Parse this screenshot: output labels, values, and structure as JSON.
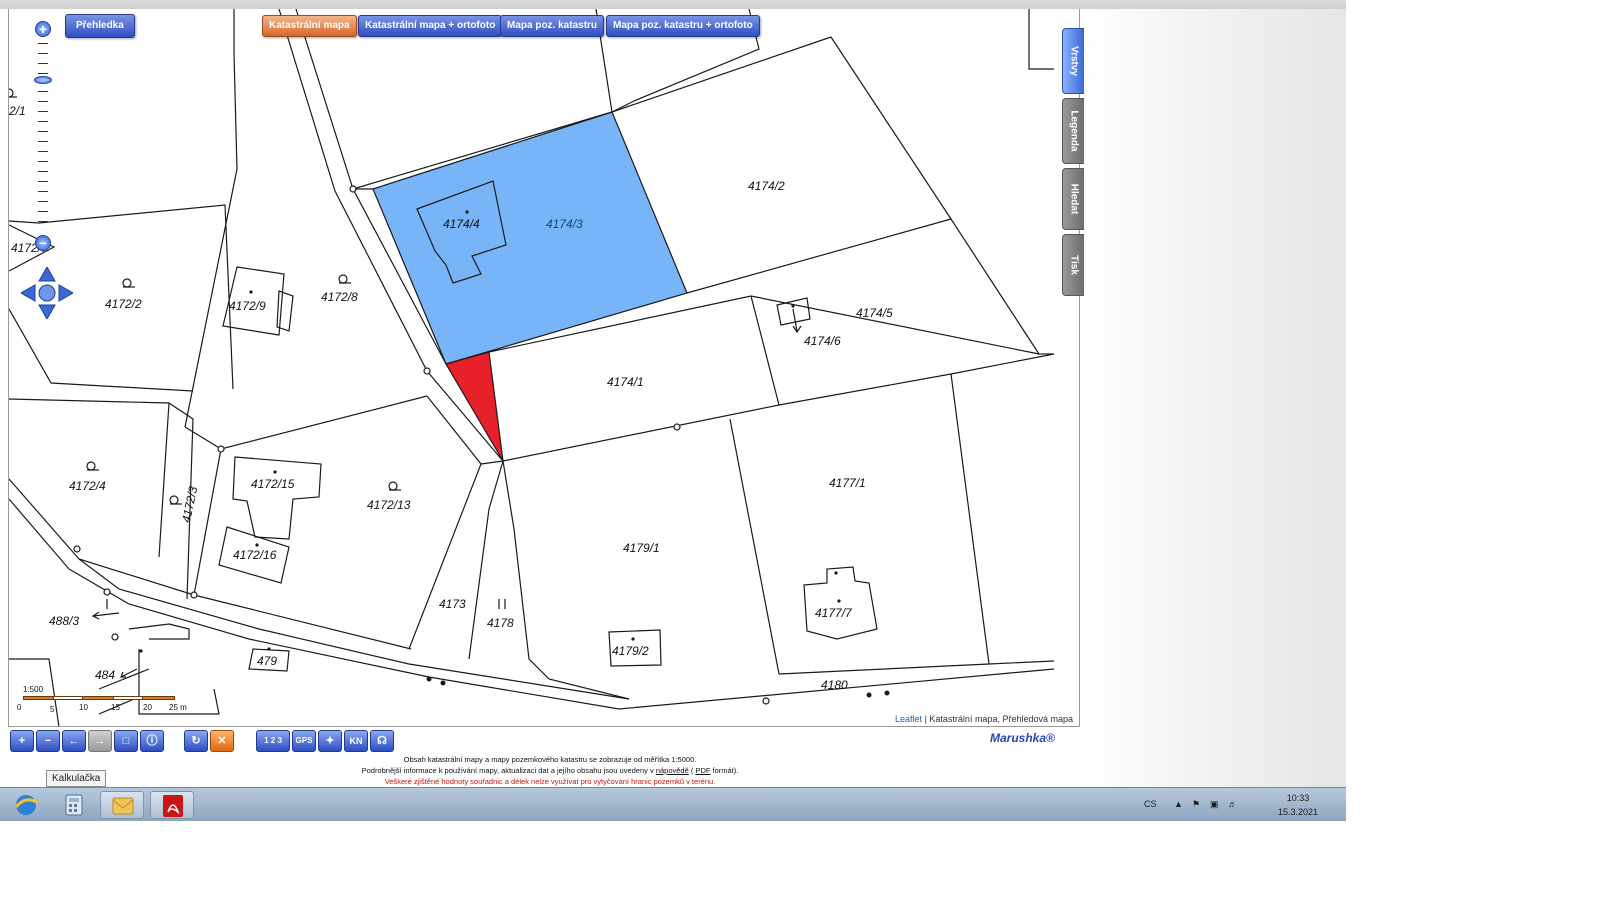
{
  "map_buttons": [
    {
      "label": "Katastrální mapa",
      "active": true
    },
    {
      "label": "Katastrální mapa + ortofoto",
      "active": false
    },
    {
      "label": "Mapa poz. katastru",
      "active": false
    },
    {
      "label": "Mapa poz. katastru + ortofoto",
      "active": false
    }
  ],
  "overview_button": "Přehledka",
  "side_tabs": [
    "Vrstvy",
    "Legenda",
    "Hledat",
    "Tisk"
  ],
  "parcel_labels": {
    "p4172_1": "2/1",
    "p4172_7": "4172/7",
    "p4172_2": "4172/2",
    "p4172_9": "4172/9",
    "p4172_8": "4172/8",
    "p4174_4": "4174/4",
    "p4174_3": "4174/3",
    "p4174_2": "4174/2",
    "p4174_5": "4174/5",
    "p4174_6": "4174/6",
    "p4174_1": "4174/1",
    "p4172_4": "4172/4",
    "p4172_3": "4172/3",
    "p4172_15": "4172/15",
    "p4172_13": "4172/13",
    "p4172_16": "4172/16",
    "p4177_1": "4177/1",
    "p4179_1": "4179/1",
    "p488_3": "488/3",
    "p4173": "4173",
    "p4178": "4178",
    "p4177_7": "4177/7",
    "p479": "479",
    "p484": "484",
    "p4179_2": "4179/2",
    "p4180": "4180"
  },
  "map_colors": {
    "selected_parcel": "#78b4f8",
    "highlight_parcel": "#e8202a",
    "line": "#1a1a1a"
  },
  "scale": {
    "ratio": "1:500",
    "ticks": [
      "0",
      "5",
      "10",
      "15",
      "20",
      "25 m"
    ]
  },
  "attribution": {
    "link": "Leaflet",
    "text": "| Katastrální mapa, Přehledová mapa"
  },
  "toolbar_icons": [
    "zoom-in-icon",
    "zoom-out-icon",
    "back-icon",
    "forward-icon",
    "select-area-icon",
    "info-icon",
    "refresh-icon",
    "clear-icon",
    "measure-icon",
    "gps-icon",
    "locate-icon",
    "kn-icon",
    "cart-icon"
  ],
  "toolbar_labels": {
    "measure": "1 2 3",
    "gps": "GPS",
    "kn": "KN"
  },
  "brand": "Marushka®",
  "notice": {
    "line1": "Obsah katastrální mapy a mapy pozemkového katastru se zobrazuje od měřítka 1:5000.",
    "line2_a": "Podrobnější informace k používání mapy, aktualizaci dat a jejího obsahu jsou uvedeny v",
    "line2_link1": "nápovědě",
    "line2_b": "(",
    "line2_link2": "PDF",
    "line2_c": "formát).",
    "line3": "Veškeré zjištěné hodnoty souřadnic a délek nelze využívat pro vytyčování hranic pozemků v terénu."
  },
  "tooltip": "Kalkulačka",
  "taskbar": {
    "apps": [
      "ie-icon",
      "calculator-icon",
      "outlook-icon",
      "acrobat-icon"
    ],
    "lang": "CS",
    "time": "10:33",
    "date": "15.3.2021"
  }
}
